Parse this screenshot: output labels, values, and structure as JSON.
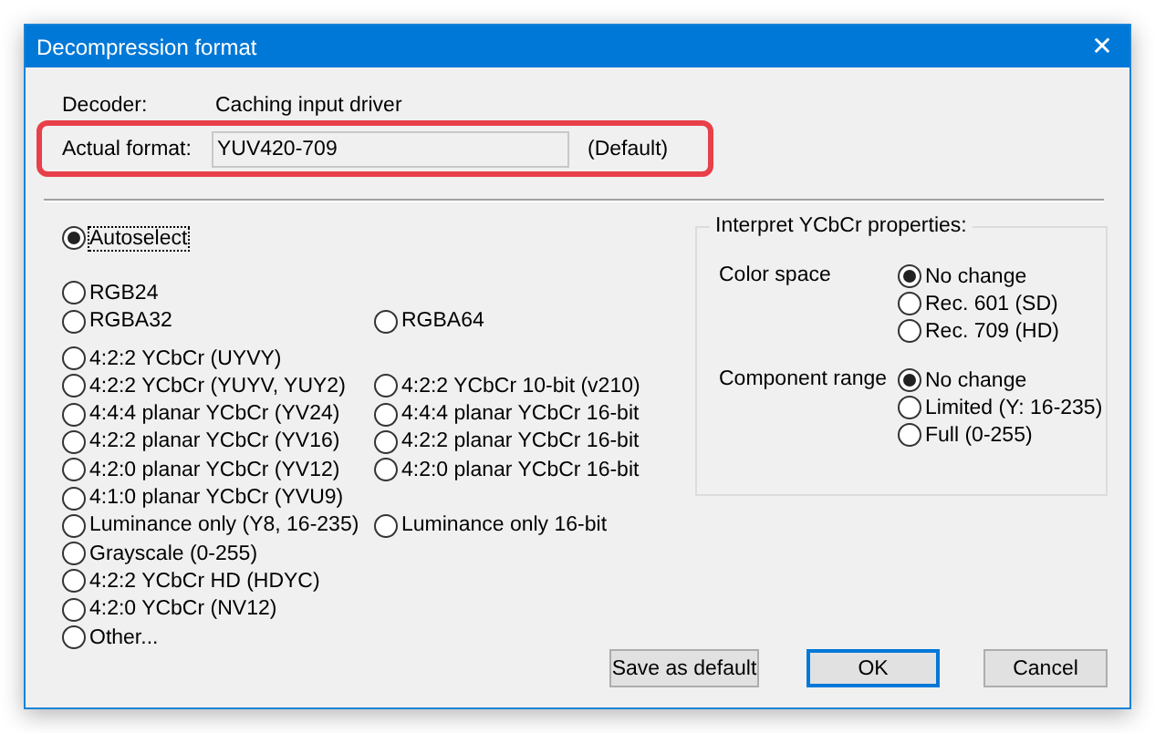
{
  "window": {
    "title": "Decompression format",
    "close": "✕"
  },
  "decoder": {
    "label": "Decoder:",
    "value": "Caching input driver"
  },
  "actual_format": {
    "label": "Actual format:",
    "value": "YUV420-709",
    "note": "(Default)",
    "highlighted": true
  },
  "formats": [
    {
      "rows": [
        [
          {
            "label": "Autoselect",
            "selected": true,
            "focused": true
          }
        ]
      ]
    },
    {
      "rows": [
        [
          {
            "label": "RGB24",
            "selected": false
          }
        ],
        [
          {
            "label": "RGBA32",
            "selected": false
          },
          {
            "label": "RGBA64",
            "selected": false
          }
        ]
      ]
    },
    {
      "rows": [
        [
          {
            "label": "4:2:2 YCbCr (UYVY)",
            "selected": false
          }
        ],
        [
          {
            "label": "4:2:2 YCbCr (YUYV, YUY2)",
            "selected": false
          },
          {
            "label": "4:2:2 YCbCr 10-bit (v210)",
            "selected": false
          }
        ],
        [
          {
            "label": "4:4:4 planar YCbCr (YV24)",
            "selected": false
          },
          {
            "label": "4:4:4 planar YCbCr 16-bit",
            "selected": false
          }
        ],
        [
          {
            "label": "4:2:2 planar YCbCr (YV16)",
            "selected": false
          },
          {
            "label": "4:2:2 planar YCbCr 16-bit",
            "selected": false
          }
        ],
        [
          {
            "label": "4:2:0 planar YCbCr (YV12)",
            "selected": false
          },
          {
            "label": "4:2:0 planar YCbCr 16-bit",
            "selected": false
          }
        ],
        [
          {
            "label": "4:1:0 planar YCbCr (YVU9)",
            "selected": false
          }
        ],
        [
          {
            "label": "Luminance only (Y8, 16-235)",
            "selected": false
          },
          {
            "label": "Luminance only 16-bit",
            "selected": false
          }
        ],
        [
          {
            "label": "Grayscale (0-255)",
            "selected": false
          }
        ],
        [
          {
            "label": "4:2:2 YCbCr HD (HDYC)",
            "selected": false
          }
        ],
        [
          {
            "label": "4:2:0 YCbCr (NV12)",
            "selected": false
          }
        ],
        [
          {
            "label": "Other...",
            "selected": false
          }
        ]
      ]
    }
  ],
  "interpret": {
    "title": "Interpret YCbCr properties:",
    "groups": [
      {
        "label": "Color space",
        "options": [
          {
            "label": "No change",
            "selected": true
          },
          {
            "label": "Rec. 601 (SD)",
            "selected": false
          },
          {
            "label": "Rec. 709 (HD)",
            "selected": false
          }
        ]
      },
      {
        "label": "Component range",
        "options": [
          {
            "label": "No change",
            "selected": true
          },
          {
            "label": "Limited (Y: 16-235)",
            "selected": false
          },
          {
            "label": "Full (0-255)",
            "selected": false
          }
        ]
      }
    ]
  },
  "buttons": [
    {
      "label": "Save as default",
      "default": false
    },
    {
      "label": "OK",
      "default": true
    },
    {
      "label": "Cancel",
      "default": false
    }
  ]
}
